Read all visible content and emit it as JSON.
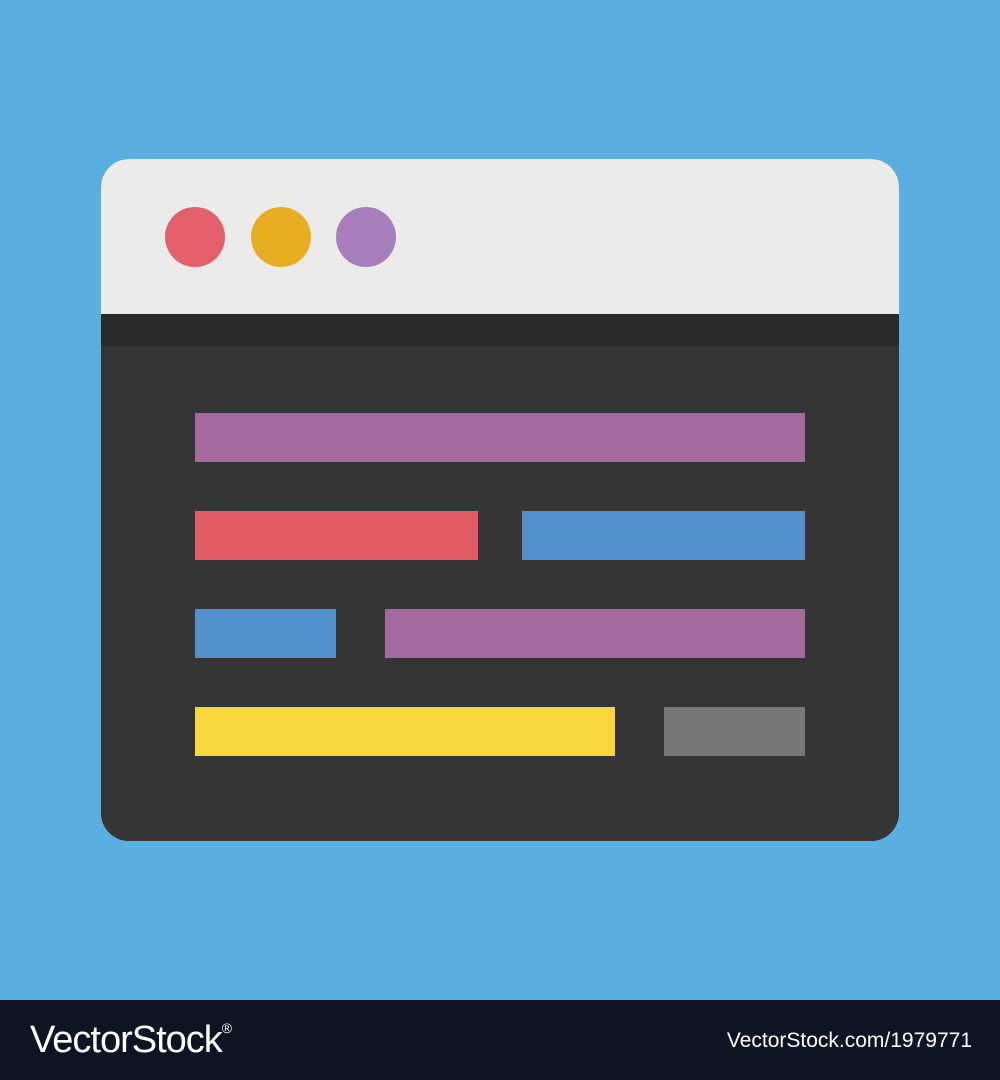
{
  "colors": {
    "background": "#5aafe0",
    "titlebar": "#ebebeb",
    "toolbar_strip": "#2b2b2b",
    "content": "#353535",
    "footer": "#0f1424",
    "footer_text": "#ffffff"
  },
  "window": {
    "controls": [
      {
        "name": "red-dot-icon",
        "color": "#e35f6a"
      },
      {
        "name": "yellow-dot-icon",
        "color": "#e8ae23"
      },
      {
        "name": "purple-dot-icon",
        "color": "#a77fbd"
      }
    ],
    "code_lines": [
      {
        "color": "#a46a9e"
      },
      {
        "color": "#e35d67"
      },
      {
        "color": "#5390cb"
      },
      {
        "color": "#5390cb"
      },
      {
        "color": "#a46a9e"
      },
      {
        "color": "#f9d73c"
      },
      {
        "color": "#777777"
      }
    ]
  },
  "footer": {
    "brand": "VectorStock",
    "brand_mark": "®",
    "image_id": "VectorStock.com/1979771"
  }
}
